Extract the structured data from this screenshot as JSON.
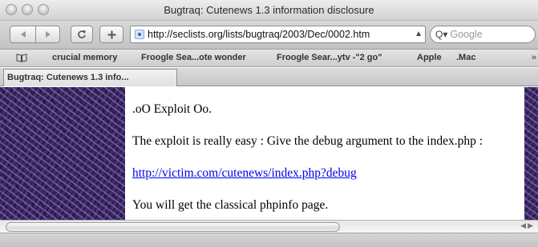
{
  "window": {
    "title": "Bugtraq: Cutenews 1.3 information disclosure"
  },
  "toolbar": {
    "back_icon": "back-arrow-icon",
    "forward_icon": "forward-arrow-icon",
    "reload_icon": "reload-icon",
    "add_icon": "plus-icon",
    "url": "http://seclists.org/lists/bugtraq/2003/Dec/0002.htm",
    "search_placeholder": "Google"
  },
  "bookmarks": {
    "items": [
      {
        "label": "crucial memory"
      },
      {
        "label": "Froogle Sea...ote wonder"
      },
      {
        "label": "Froogle Sear...ytv -\"2 go\""
      },
      {
        "label": "Apple"
      },
      {
        "label": ".Mac"
      }
    ],
    "more_label": "»"
  },
  "tabs": [
    {
      "label": "Bugtraq: Cutenews 1.3 info..."
    }
  ],
  "page": {
    "lines": [
      ".oO Exploit Oo.",
      "The exploit is really easy : Give the debug argument to the index.php :",
      "http://victim.com/cutenews/index.php?debug",
      "You will get the classical phpinfo page."
    ]
  },
  "colors": {
    "link": "#0000ee",
    "background_texture": "#3f2c67"
  }
}
